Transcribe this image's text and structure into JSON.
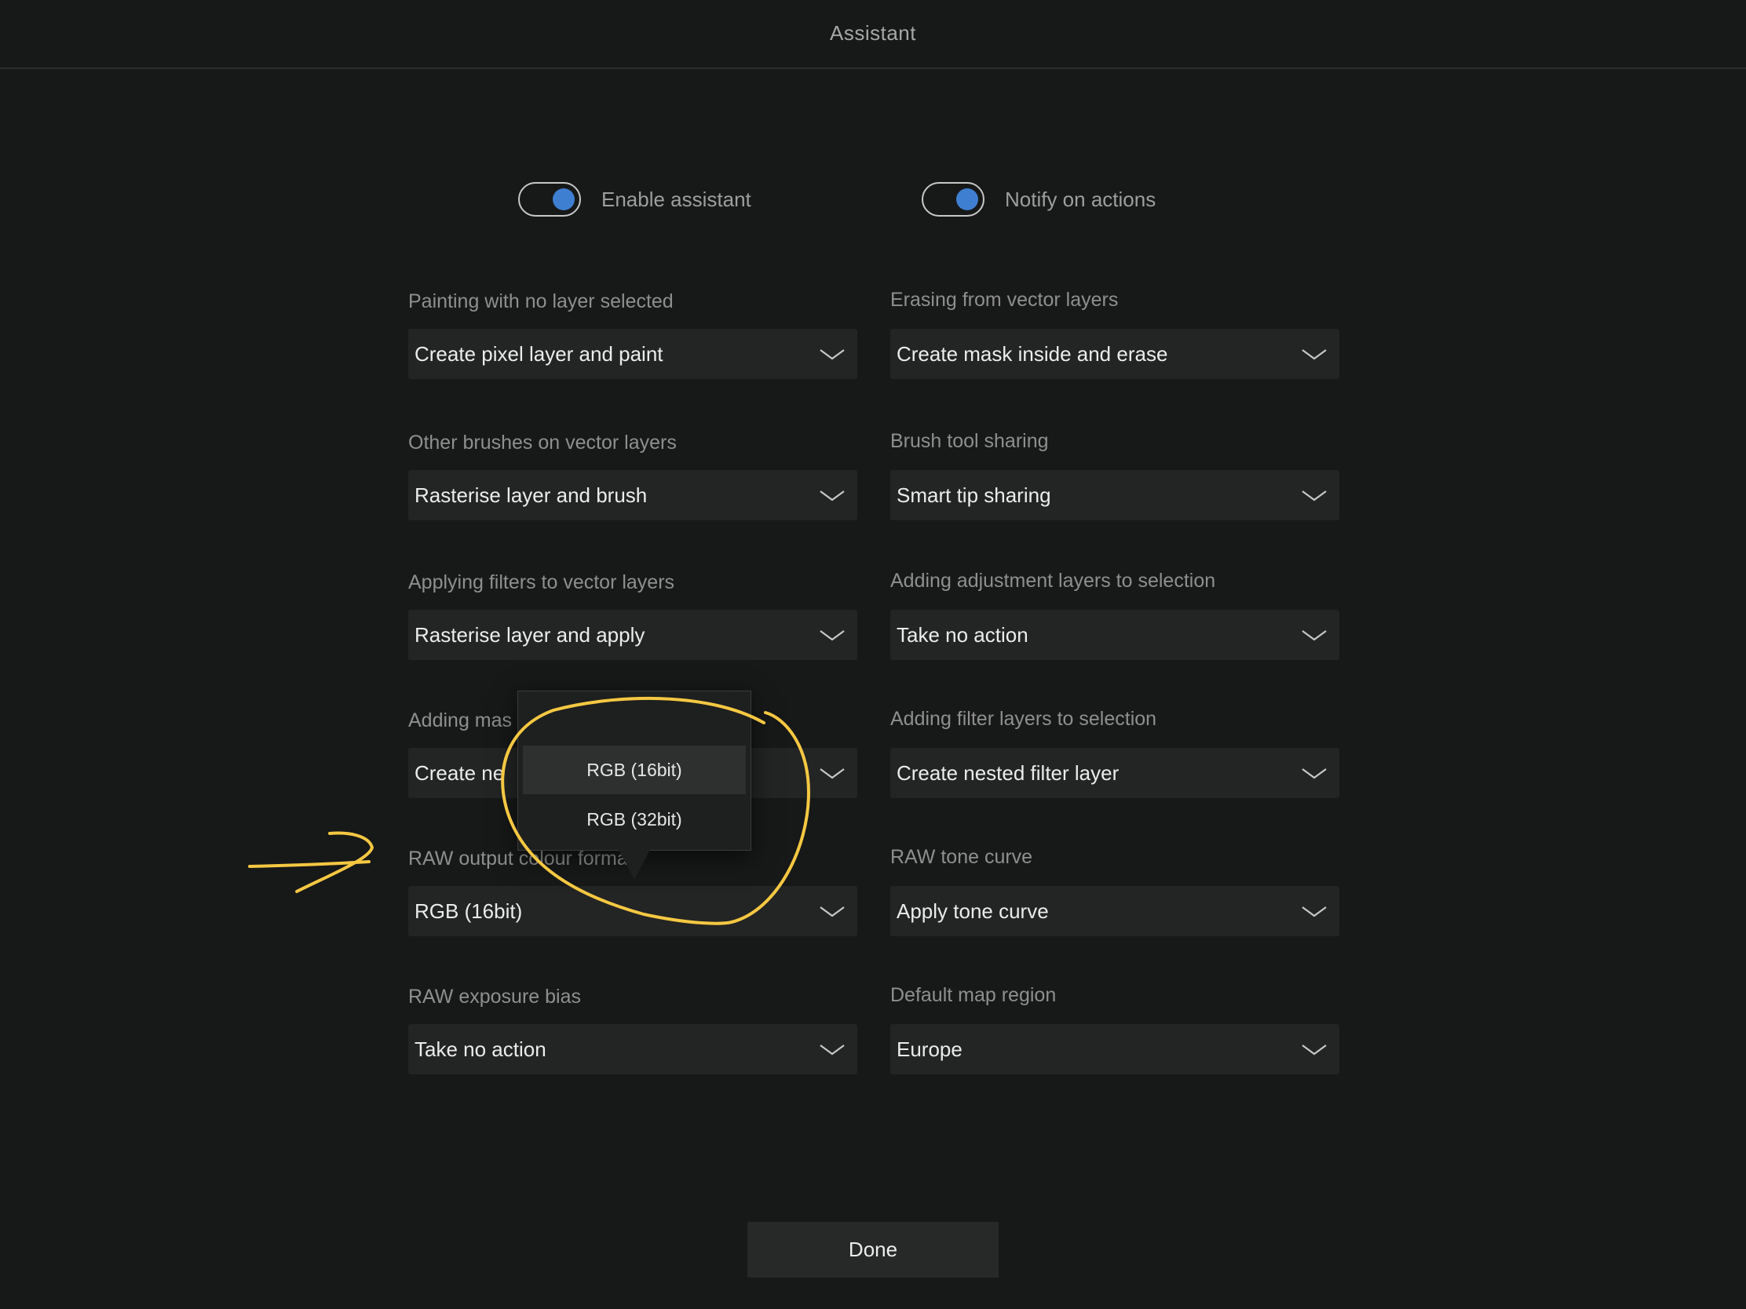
{
  "header": {
    "title": "Assistant"
  },
  "toggles": [
    {
      "label": "Enable assistant",
      "on": true
    },
    {
      "label": "Notify on actions",
      "on": true
    }
  ],
  "fields": [
    {
      "label": "Painting with no layer selected",
      "value": "Create pixel layer and paint"
    },
    {
      "label": "Erasing from vector layers",
      "value": "Create mask inside and erase"
    },
    {
      "label": "Other brushes on vector layers",
      "value": "Rasterise layer and brush"
    },
    {
      "label": "Brush tool sharing",
      "value": "Smart tip sharing"
    },
    {
      "label": "Applying filters to vector layers",
      "value": "Rasterise layer and apply"
    },
    {
      "label": "Adding adjustment layers to selection",
      "value": "Take no action"
    },
    {
      "label": "Adding mas",
      "value": "Create ne"
    },
    {
      "label": "Adding filter layers to selection",
      "value": "Create nested filter layer"
    },
    {
      "label": "RAW output colour format",
      "value": "RGB (16bit)"
    },
    {
      "label": "RAW tone curve",
      "value": "Apply tone curve"
    },
    {
      "label": "RAW exposure bias",
      "value": "Take no action"
    },
    {
      "label": "Default map region",
      "value": "Europe"
    }
  ],
  "popover": {
    "options": [
      "RGB (16bit)",
      "RGB (32bit)"
    ],
    "selected": "RGB (16bit)"
  },
  "done_label": "Done",
  "colors": {
    "background": "#171818",
    "select_bg": "#232424",
    "toggle_knob": "#3e7fd1",
    "annotation": "#f5c842"
  }
}
